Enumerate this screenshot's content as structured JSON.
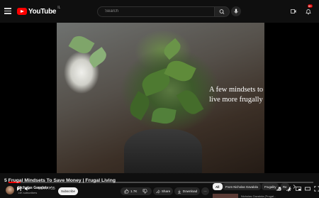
{
  "header": {
    "logo_text": "YouTube",
    "logo_sup": "IL",
    "search_placeholder": "Search",
    "notification_count": "9+"
  },
  "video": {
    "overlay_text": "A few mindsets to live more frugally",
    "progress": 0.04,
    "time": "0:24 / 7:35"
  },
  "info": {
    "title": "5 Frugal Mindsets To Save Money | Frugal Living",
    "channel": "Nicholas Gavalola ✓",
    "subscribers": "14K subscribers",
    "subscribe_label": "Subscribe",
    "like_count": "1.7K",
    "share_label": "Share",
    "download_label": "Download",
    "more_label": "···"
  },
  "chips": [
    "All",
    "From Nicholas Gavalola",
    "Frugality",
    "Re"
  ],
  "upnext": {
    "text": "Nicholas Gavalola (Frugal..."
  }
}
